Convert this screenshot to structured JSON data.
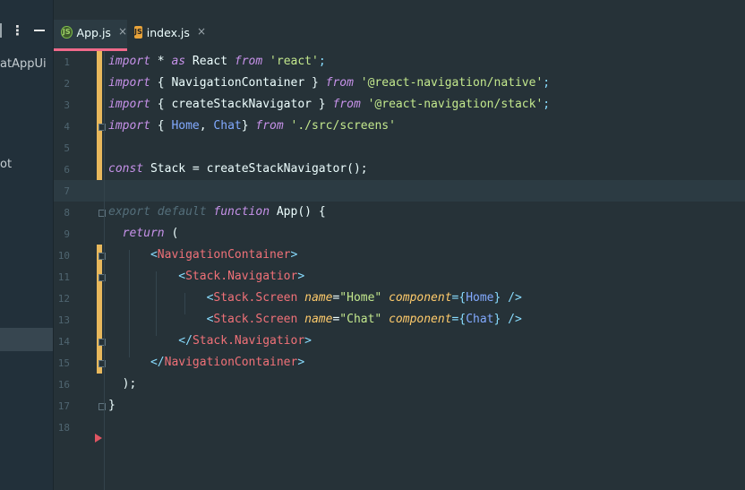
{
  "sidebar": {
    "project_fragment": "atAppUi",
    "folder_fragment": "ot"
  },
  "tabs": [
    {
      "label": "App.js",
      "icon": "nodejs-icon",
      "active": true
    },
    {
      "label": "index.js",
      "icon": "js-file-icon",
      "active": false
    }
  ],
  "tab_close_glyph": "×",
  "editor": {
    "line_numbers": [
      "1",
      "2",
      "3",
      "4",
      "5",
      "6",
      "7",
      "8",
      "9",
      "10",
      "11",
      "12",
      "13",
      "14",
      "15",
      "16",
      "17",
      "18"
    ],
    "lines": {
      "l1": {
        "a": "import",
        "b": " * ",
        "c": "as",
        "d": " React ",
        "e": "from",
        "f": " ",
        "g": "'react'",
        "h": ";"
      },
      "l2": {
        "a": "import",
        "b": " { NavigationContainer } ",
        "c": "from",
        "d": " ",
        "e": "'@react-navigation/native'",
        "f": ";"
      },
      "l3": {
        "a": "import",
        "b": " { createStackNavigator } ",
        "c": "from",
        "d": " ",
        "e": "'@react-navigation/stack'",
        "f": ";"
      },
      "l4": {
        "a": "import",
        "b": " { ",
        "c": "Home",
        "d": ", ",
        "e": "Chat",
        "f": "} ",
        "g": "from",
        "h": " ",
        "i": "'./src/screens'"
      },
      "l6": {
        "a": "const",
        "b": " Stack = createStackNavigator();"
      },
      "l8": {
        "a": "export default",
        "b": " ",
        "c": "function",
        "d": " App() {"
      },
      "l9": {
        "a": "  ",
        "b": "return",
        "c": " ("
      },
      "l10": {
        "a": "      ",
        "b": "<",
        "c": "NavigationContainer",
        "d": ">"
      },
      "l11": {
        "a": "          ",
        "b": "<",
        "c": "Stack.Navigatior",
        "d": ">"
      },
      "l12": {
        "a": "              ",
        "b": "<",
        "c": "Stack.Screen",
        "d": " ",
        "e": "name",
        "f": "=",
        "g": "\"Home\"",
        "h": " ",
        "i": "component",
        "j": "={",
        "k": "Home",
        "l": "}",
        "m": " />"
      },
      "l13": {
        "a": "              ",
        "b": "<",
        "c": "Stack.Screen",
        "d": " ",
        "e": "name",
        "f": "=",
        "g": "\"Chat\"",
        "h": " ",
        "i": "component",
        "j": "={",
        "k": "Chat",
        "l": "}",
        "m": " />"
      },
      "l14": {
        "a": "          ",
        "b": "</",
        "c": "Stack.Navigatior",
        "d": ">"
      },
      "l15": {
        "a": "      ",
        "b": "</",
        "c": "NavigationContainer",
        "d": ">"
      },
      "l16": {
        "a": "  );"
      },
      "l17": {
        "a": "}"
      }
    }
  },
  "colors": {
    "background": "#263238",
    "keyword": "#c792ea",
    "string": "#c3e88d",
    "tag": "#f07178",
    "attribute": "#ffcb6b",
    "component": "#82aaff",
    "modified_marker": "#e8b85c",
    "active_tab_underline": "#f06a8a"
  }
}
